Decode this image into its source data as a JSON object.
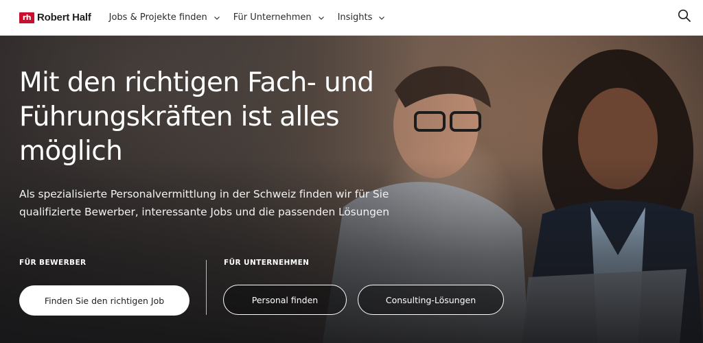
{
  "header": {
    "logo_mark": "rh",
    "logo_text": "Robert Half",
    "nav": [
      {
        "label": "Jobs & Projekte finden"
      },
      {
        "label": "Für Unternehmen"
      },
      {
        "label": "Insights"
      }
    ],
    "search_icon": "search-icon"
  },
  "hero": {
    "title": "Mit den richtigen Fach- und Führungskräften ist alles möglich",
    "subtitle": "Als spezialisierte Personalvermittlung in der Schweiz finden wir für Sie qualifizierte Bewerber, interessante Jobs und die passenden Lösungen",
    "candidates": {
      "label": "FÜR BEWERBER",
      "button": "Finden Sie den richtigen Job"
    },
    "employers": {
      "label": "FÜR UNTERNEHMEN",
      "button_personal": "Personal finden",
      "button_consulting": "Consulting-Lösungen"
    }
  },
  "colors": {
    "brand": "#c8102e",
    "header_bg": "#ffffff",
    "hero_text": "#ffffff",
    "primary_button_bg": "#ffffff"
  }
}
